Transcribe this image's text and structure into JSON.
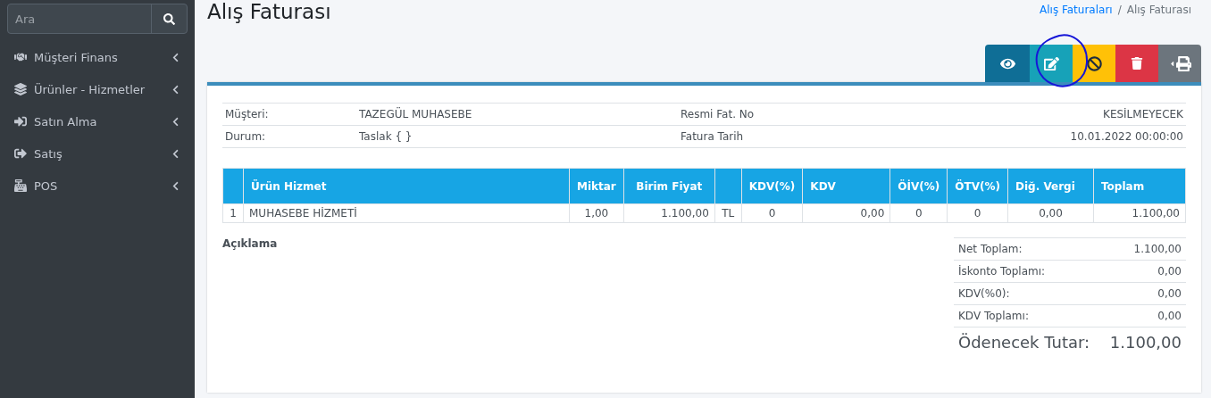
{
  "sidebar": {
    "search": {
      "placeholder": "Ara"
    },
    "items": [
      {
        "label": "Müşteri Finans",
        "expanded": false
      },
      {
        "label": "Ürünler - Hizmetler",
        "expanded": false
      },
      {
        "label": "Satın Alma",
        "expanded": false
      },
      {
        "label": "Satış",
        "expanded": false
      },
      {
        "label": "POS",
        "expanded": false
      }
    ]
  },
  "page": {
    "title": "Alış Faturası",
    "breadcrumb_separator": "/",
    "breadcrumb": [
      {
        "label": "Alış Faturaları",
        "link": true
      },
      {
        "label": "Alış Faturası",
        "link": false
      }
    ]
  },
  "actions": [
    {
      "kind": "view",
      "color": "#0f6e96"
    },
    {
      "kind": "edit",
      "color": "#17a2b8"
    },
    {
      "kind": "cancel",
      "color": "#ffc107"
    },
    {
      "kind": "delete",
      "color": "#dc3545"
    },
    {
      "kind": "print",
      "color": "#6c757d"
    }
  ],
  "annotation": {
    "kind": "circle"
  },
  "info": [
    {
      "label": "Müşteri:",
      "value": "TAZEGÜL MUHASEBE",
      "label2": "Resmi Fat. No",
      "value2": "KESİLMEYECEK"
    },
    {
      "label": "Durum:",
      "value": "Taslak { }",
      "label2": "Fatura Tarih",
      "value2": "10.01.2022 00:00:00"
    }
  ],
  "items_table": {
    "columns": [
      {
        "kind": "blank"
      },
      {
        "kind": "text",
        "label": "Ürün Hizmet"
      },
      {
        "kind": "text",
        "label": "Miktar"
      },
      {
        "kind": "text",
        "label": "Birim Fiyat"
      },
      {
        "kind": "blank"
      },
      {
        "kind": "text",
        "label": "KDV(%)"
      },
      {
        "kind": "text",
        "label": "KDV"
      },
      {
        "kind": "text",
        "label": "ÖİV(%)"
      },
      {
        "kind": "text",
        "label": "ÖTV(%)"
      },
      {
        "kind": "text",
        "label": "Diğ. Vergi"
      },
      {
        "kind": "text",
        "label": "Toplam"
      }
    ],
    "rows": [
      {
        "cells": [
          "1",
          "MUHASEBE HİZMETİ",
          "1,00",
          "1.100,00",
          "TL",
          "0",
          "0,00",
          "0",
          "0",
          "0,00",
          "1.100,00"
        ]
      }
    ]
  },
  "description_label": "Açıklama",
  "totals": [
    {
      "label": "Net Toplam:",
      "value": "1.100,00"
    },
    {
      "label": "İskonto Toplamı:",
      "value": "0,00"
    },
    {
      "label": "KDV(%0):",
      "value": "0,00"
    },
    {
      "label": "KDV Toplamı:",
      "value": "0,00"
    }
  ],
  "grand_total": {
    "label": "Ödenecek Tutar:",
    "value": "1.100,00"
  }
}
